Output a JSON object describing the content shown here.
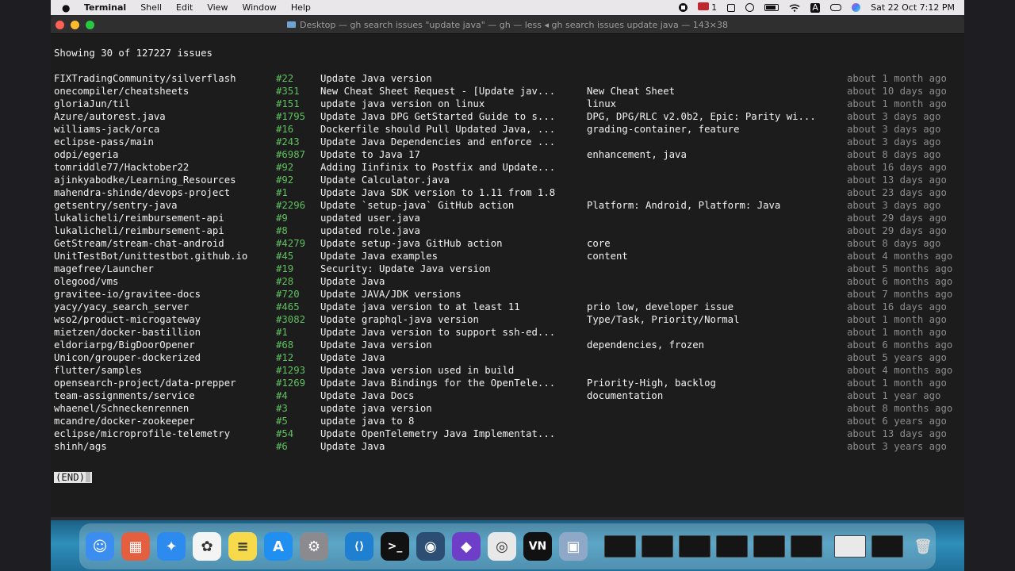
{
  "menubar": {
    "apple": "",
    "app": "Terminal",
    "menus": [
      "Shell",
      "Edit",
      "View",
      "Window",
      "Help"
    ],
    "mail_badge": "1",
    "input_source": "A",
    "datetime": "Sat 22 Oct  7:12 PM"
  },
  "window": {
    "title": "Desktop — gh search issues \"update java\" — gh — less ◂ gh search issues update java — 143×38"
  },
  "terminal": {
    "summary": "Showing 30 of 127227 issues",
    "end_marker": "(END)",
    "rows": [
      {
        "repo": "FIXTradingCommunity/silverflash",
        "number": "#22",
        "title": "Update Java version",
        "labels": "",
        "time": "about 1 month ago"
      },
      {
        "repo": "onecompiler/cheatsheets",
        "number": "#351",
        "title": "New Cheat Sheet Request - [Update jav...",
        "labels": "New Cheat Sheet",
        "time": "about 10 days ago"
      },
      {
        "repo": "gloriaJun/til",
        "number": "#151",
        "title": "update java version on linux",
        "labels": "linux",
        "time": "about 1 month ago"
      },
      {
        "repo": "Azure/autorest.java",
        "number": "#1795",
        "title": "Update Java DPG GetStarted Guide to s...",
        "labels": "DPG, DPG/RLC v2.0b2, Epic: Parity wi...",
        "time": "about 3 days ago"
      },
      {
        "repo": "williams-jack/orca",
        "number": "#16",
        "title": "Dockerfile should Pull Updated Java, ...",
        "labels": "grading-container, feature",
        "time": "about 3 days ago"
      },
      {
        "repo": "eclipse-pass/main",
        "number": "#243",
        "title": "Update Java Dependencies and enforce ...",
        "labels": "",
        "time": "about 3 days ago"
      },
      {
        "repo": "odpi/egeria",
        "number": "#6987",
        "title": "Update to Java 17",
        "labels": "enhancement, java",
        "time": "about 8 days ago"
      },
      {
        "repo": "tomriddle77/Hacktober22",
        "number": "#92",
        "title": "Adding Iinfinix to Postfix and Update...",
        "labels": "",
        "time": "about 16 days ago"
      },
      {
        "repo": "ajinkyabodke/Learning_Resources",
        "number": "#92",
        "title": "Update Calculator.java",
        "labels": "",
        "time": "about 13 days ago"
      },
      {
        "repo": "mahendra-shinde/devops-project",
        "number": "#1",
        "title": "Update Java SDK version to 1.11 from 1.8",
        "labels": "",
        "time": "about 23 days ago"
      },
      {
        "repo": "getsentry/sentry-java",
        "number": "#2296",
        "title": "Update `setup-java` GitHub action",
        "labels": "Platform: Android, Platform: Java",
        "time": "about 3 days ago"
      },
      {
        "repo": "lukalicheli/reimbursement-api",
        "number": "#9",
        "title": "updated user.java",
        "labels": "",
        "time": "about 29 days ago"
      },
      {
        "repo": "lukalicheli/reimbursement-api",
        "number": "#8",
        "title": "updated role.java",
        "labels": "",
        "time": "about 29 days ago"
      },
      {
        "repo": "GetStream/stream-chat-android",
        "number": "#4279",
        "title": "Update setup-java GitHub action",
        "labels": "core",
        "time": "about 8 days ago"
      },
      {
        "repo": "UnitTestBot/unittestbot.github.io",
        "number": "#45",
        "title": "Update Java examples",
        "labels": "content",
        "time": "about 4 months ago"
      },
      {
        "repo": "magefree/Launcher",
        "number": "#19",
        "title": "Security: Update Java version",
        "labels": "",
        "time": "about 5 months ago"
      },
      {
        "repo": "olegood/vms",
        "number": "#28",
        "title": "Update Java",
        "labels": "",
        "time": "about 6 months ago"
      },
      {
        "repo": "gravitee-io/gravitee-docs",
        "number": "#720",
        "title": "Update JAVA/JDK versions",
        "labels": "",
        "time": "about 7 months ago"
      },
      {
        "repo": "yacy/yacy_search_server",
        "number": "#465",
        "title": "Update java version to at least 11",
        "labels": "prio low, developer issue",
        "time": "about 16 days ago"
      },
      {
        "repo": "wso2/product-microgateway",
        "number": "#3082",
        "title": "Update graphql-java version",
        "labels": "Type/Task, Priority/Normal",
        "time": "about 1 month ago"
      },
      {
        "repo": "mietzen/docker-bastillion",
        "number": "#1",
        "title": "Update Java version to support ssh-ed...",
        "labels": "",
        "time": "about 1 month ago"
      },
      {
        "repo": "eldoriarpg/BigDoorOpener",
        "number": "#68",
        "title": "Update Java version",
        "labels": "dependencies, frozen",
        "time": "about 6 months ago"
      },
      {
        "repo": "Unicon/grouper-dockerized",
        "number": "#12",
        "title": "Update Java",
        "labels": "",
        "time": "about 5 years ago"
      },
      {
        "repo": "flutter/samples",
        "number": "#1293",
        "title": "Update Java version used in build",
        "labels": "",
        "time": "about 4 months ago"
      },
      {
        "repo": "opensearch-project/data-prepper",
        "number": "#1269",
        "title": "Update Java Bindings for the OpenTele...",
        "labels": "Priority-High, backlog",
        "time": "about 1 month ago"
      },
      {
        "repo": "team-assignments/service",
        "number": "#4",
        "title": "Update Java Docs",
        "labels": "documentation",
        "time": "about 1 year ago"
      },
      {
        "repo": "whaenel/Schneckenrennen",
        "number": "#3",
        "title": "update java version",
        "labels": "",
        "time": "about 8 months ago"
      },
      {
        "repo": "mcandre/docker-zookeeper",
        "number": "#5",
        "title": "update java to 8",
        "labels": "",
        "time": "about 6 years ago"
      },
      {
        "repo": "eclipse/microprofile-telemetry",
        "number": "#54",
        "title": "Update OpenTelemetry Java Implementat...",
        "labels": "",
        "time": "about 13 days ago"
      },
      {
        "repo": "shinh/ags",
        "number": "#6",
        "title": "Update Java",
        "labels": "",
        "time": "about 3 years ago"
      }
    ]
  },
  "dock": {
    "apps": [
      {
        "name": "finder-icon",
        "glyph": "☺",
        "color": "#3b8ef0"
      },
      {
        "name": "launchpad-icon",
        "glyph": "▦",
        "color": "#e35f3f"
      },
      {
        "name": "safari-icon",
        "glyph": "✦",
        "color": "#2d8bf0"
      },
      {
        "name": "photos-icon",
        "glyph": "✿",
        "color": "#f4f4f4"
      },
      {
        "name": "notes-icon",
        "glyph": "≡",
        "color": "#f7d94c"
      },
      {
        "name": "app-store-icon",
        "glyph": "A",
        "color": "#1f8ff1"
      },
      {
        "name": "system-settings-icon",
        "glyph": "⚙",
        "color": "#8a8a8f"
      },
      {
        "name": "vscode-icon",
        "glyph": "⟨⟩",
        "color": "#1f7fd0"
      },
      {
        "name": "terminal-icon",
        "glyph": ">_",
        "color": "#111111"
      },
      {
        "name": "proxyman-icon",
        "glyph": "◉",
        "color": "#2d4e73"
      },
      {
        "name": "github-desktop-icon",
        "glyph": "◆",
        "color": "#6e3ec9"
      },
      {
        "name": "chrome-icon",
        "glyph": "◎",
        "color": "#e8e8e8"
      },
      {
        "name": "vn-icon",
        "glyph": "VN",
        "color": "#111111"
      },
      {
        "name": "preview-icon",
        "glyph": "▣",
        "color": "#8fa8c8"
      }
    ],
    "thumbs": 8,
    "trash_glyph": "🗑"
  },
  "colors": {
    "issue_number": "#5fc05f",
    "timestamp": "#8c8c8c",
    "terminal_bg": "#1c1c1c"
  }
}
